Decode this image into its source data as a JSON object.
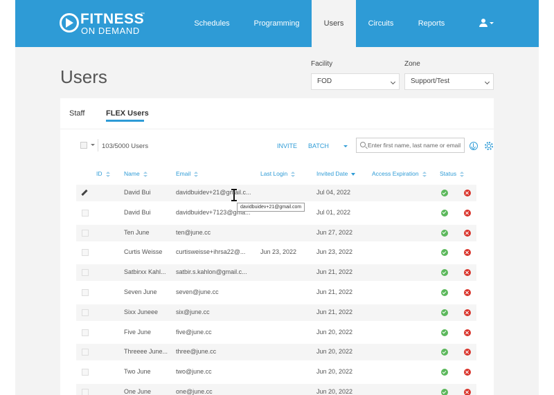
{
  "header": {
    "logo_line1": "FITNESS",
    "logo_line2": "ON DEMAND",
    "logo_tm": "™",
    "nav": [
      {
        "label": "Schedules",
        "active": false
      },
      {
        "label": "Programming",
        "active": false
      },
      {
        "label": "Users",
        "active": true
      },
      {
        "label": "Circuits",
        "active": false
      },
      {
        "label": "Reports",
        "active": false
      }
    ],
    "user_menu_icon": "user-icon"
  },
  "page": {
    "title": "Users",
    "facility": {
      "label": "Facility",
      "value": "FOD"
    },
    "zone": {
      "label": "Zone",
      "value": "Support/Test"
    }
  },
  "tabs": [
    {
      "label": "Staff",
      "active": false
    },
    {
      "label": "FLEX Users",
      "active": true
    }
  ],
  "toolbar": {
    "count": "103/5000 Users",
    "invite_label": "INVITE",
    "batch_label": "BATCH",
    "search_placeholder": "Enter first name, last name or email",
    "download_icon": "download-icon",
    "settings_icon": "gear-icon"
  },
  "table": {
    "columns": [
      "ID",
      "Name",
      "Email",
      "Last Login",
      "Invited Date",
      "Access Expiration",
      "Status"
    ],
    "sorted_column": "Invited Date",
    "rows": [
      {
        "id": "",
        "name": "David Bui",
        "email": "davidbuidev+21@gmail.c...",
        "last_login": "",
        "invited": "Jul 04, 2022",
        "expiration": "",
        "status": "active",
        "editing": true
      },
      {
        "id": "",
        "name": "David Bui",
        "email": "davidbuidev+7123@gma...",
        "last_login": "",
        "invited": "Jul 01, 2022",
        "expiration": "",
        "status": "active",
        "editing": false
      },
      {
        "id": "",
        "name": "Ten June",
        "email": "ten@june.cc",
        "last_login": "",
        "invited": "Jun 27, 2022",
        "expiration": "",
        "status": "active",
        "editing": false
      },
      {
        "id": "",
        "name": "Curtis Weisse",
        "email": "curtisweisse+ihrsa22@...",
        "last_login": "Jun 23, 2022",
        "invited": "Jun 23, 2022",
        "expiration": "",
        "status": "active",
        "editing": false
      },
      {
        "id": "",
        "name": "Satbirxx Kahl...",
        "email": "satbir.s.kahlon@gmail.c...",
        "last_login": "",
        "invited": "Jun 21, 2022",
        "expiration": "",
        "status": "active",
        "editing": false
      },
      {
        "id": "",
        "name": "Seven June",
        "email": "seven@june.cc",
        "last_login": "",
        "invited": "Jun 21, 2022",
        "expiration": "",
        "status": "active",
        "editing": false
      },
      {
        "id": "",
        "name": "Sixx Juneee",
        "email": "six@june.cc",
        "last_login": "",
        "invited": "Jun 21, 2022",
        "expiration": "",
        "status": "active",
        "editing": false
      },
      {
        "id": "",
        "name": "Five June",
        "email": "five@june.cc",
        "last_login": "",
        "invited": "Jun 20, 2022",
        "expiration": "",
        "status": "active",
        "editing": false
      },
      {
        "id": "",
        "name": "Threeee June...",
        "email": "three@june.cc",
        "last_login": "",
        "invited": "Jun 20, 2022",
        "expiration": "",
        "status": "active",
        "editing": false
      },
      {
        "id": "",
        "name": "Two June",
        "email": "two@june.cc",
        "last_login": "",
        "invited": "Jun 20, 2022",
        "expiration": "",
        "status": "active",
        "editing": false
      },
      {
        "id": "",
        "name": "One June",
        "email": "one@june.cc",
        "last_login": "",
        "invited": "Jun 20, 2022",
        "expiration": "",
        "status": "active",
        "editing": false
      }
    ]
  },
  "tooltip": {
    "text": "davidbuidev+21@gmail.com"
  },
  "colors": {
    "brand": "#2e9bd6",
    "success": "#5cb85c",
    "danger": "#d9342b"
  }
}
